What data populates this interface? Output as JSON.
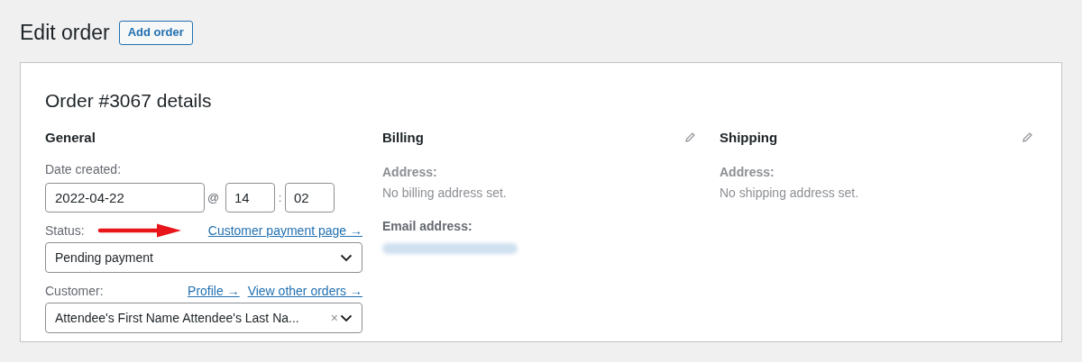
{
  "page_title": "Edit order",
  "add_button": "Add order",
  "order": {
    "title": "Order #3067 details",
    "general": {
      "heading": "General",
      "date_label": "Date created:",
      "date": "2022-04-22",
      "at": "@",
      "hour": "14",
      "colon": ":",
      "minute": "02",
      "status_label": "Status:",
      "payment_link": "Customer payment page →",
      "status": "Pending payment",
      "customer_label": "Customer:",
      "profile_link": "Profile →",
      "orders_link": "View other orders →",
      "customer": "Attendee's First Name Attendee's Last Na...",
      "clear": "×"
    },
    "billing": {
      "heading": "Billing",
      "address_label": "Address:",
      "address": "No billing address set.",
      "email_label": "Email address:"
    },
    "shipping": {
      "heading": "Shipping",
      "address_label": "Address:",
      "address": "No shipping address set."
    }
  }
}
